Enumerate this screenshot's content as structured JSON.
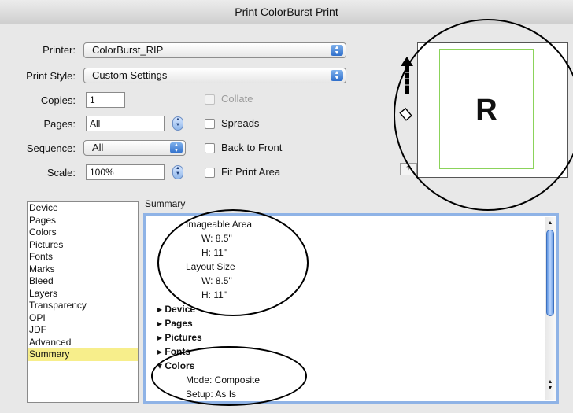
{
  "window": {
    "title": "Print ColorBurst Print"
  },
  "form": {
    "printer_label": "Printer:",
    "printer_value": "ColorBurst_RIP",
    "print_style_label": "Print Style:",
    "print_style_value": "Custom Settings",
    "copies_label": "Copies:",
    "copies_value": "1",
    "pages_label": "Pages:",
    "pages_value": "All",
    "sequence_label": "Sequence:",
    "sequence_value": "All",
    "scale_label": "Scale:",
    "scale_value": "100%",
    "collate_label": "Collate",
    "spreads_label": "Spreads",
    "back_to_front_label": "Back to Front",
    "fit_print_area_label": "Fit Print Area",
    "help_label": "?"
  },
  "preview": {
    "page_letter": "R"
  },
  "sidebar": {
    "items": [
      {
        "label": "Device"
      },
      {
        "label": "Pages"
      },
      {
        "label": "Colors"
      },
      {
        "label": "Pictures"
      },
      {
        "label": "Fonts"
      },
      {
        "label": "Marks"
      },
      {
        "label": "Bleed"
      },
      {
        "label": "Layers"
      },
      {
        "label": "Transparency"
      },
      {
        "label": "OPI"
      },
      {
        "label": "JDF"
      },
      {
        "label": "Advanced"
      },
      {
        "label": "Summary"
      }
    ],
    "selected": "Summary"
  },
  "summary": {
    "heading": "Summary",
    "imageable_area": "Imageable Area",
    "ia_w": "W: 8.5\"",
    "ia_h": "H: 11\"",
    "layout_size": "Layout Size",
    "ls_w": "W: 8.5\"",
    "ls_h": "H: 11\"",
    "device": "Device",
    "pages": "Pages",
    "pictures": "Pictures",
    "fonts": "Fonts",
    "colors": "Colors",
    "mode": "Mode: Composite",
    "setup": "Setup: As Is"
  },
  "colors": {
    "selection": "#f7ee8b",
    "page_border": "#8bd35a",
    "focus_ring": "#8fb3e6"
  }
}
